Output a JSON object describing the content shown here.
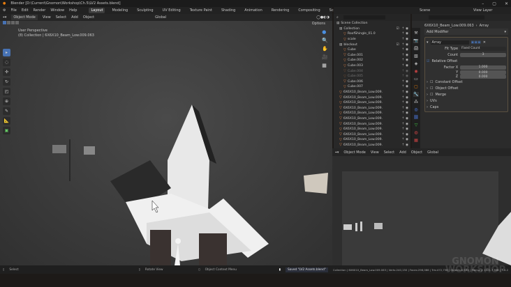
{
  "window": {
    "title": "Blender [D:\\Current\\Gnomon\\Workshop\\Ch.5\\LV2 Assets.blend]"
  },
  "menu": [
    "File",
    "Edit",
    "Render",
    "Window",
    "Help"
  ],
  "workspaces": [
    "Layout",
    "Modeling",
    "Sculpting",
    "UV Editing",
    "Texture Paint",
    "Shading",
    "Animation",
    "Rendering",
    "Compositing",
    "Scripting"
  ],
  "viewport": {
    "mode": "Object Mode",
    "menus": [
      "View",
      "Select",
      "Add",
      "Object"
    ],
    "transform": "Global",
    "options": "Options",
    "perspective": "User Perspective",
    "info": "(8) Collection | 6X6X10_Beam_Low.009.063"
  },
  "topright": {
    "scene": "Scene",
    "view_layer": "View Layer"
  },
  "outliner": {
    "root": "Scene Collection",
    "items": [
      {
        "name": "Collection",
        "type": "collection"
      },
      {
        "name": "RoofShingle_01.0",
        "type": "object"
      },
      {
        "name": "scale",
        "type": "object"
      },
      {
        "name": "blockout",
        "type": "collection"
      },
      {
        "name": "Cube",
        "type": "object"
      },
      {
        "name": "Cube.001",
        "type": "object"
      },
      {
        "name": "Cube.002",
        "type": "object"
      },
      {
        "name": "Cube.003",
        "type": "object"
      },
      {
        "name": "Cube.004",
        "type": "object",
        "hidden": true
      },
      {
        "name": "Cube.005",
        "type": "object",
        "hidden": true
      },
      {
        "name": "Cube.006",
        "type": "object"
      },
      {
        "name": "Cube.007",
        "type": "object"
      },
      {
        "name": "6X6X10_Beam_Low.009.",
        "type": "object"
      },
      {
        "name": "6X6X10_Beam_Low.009.",
        "type": "object"
      },
      {
        "name": "6X6X10_Beam_Low.009.",
        "type": "object"
      },
      {
        "name": "6X6X10_Beam_Low.009.",
        "type": "object"
      },
      {
        "name": "6X6X10_Beam_Low.009.",
        "type": "object"
      },
      {
        "name": "6X6X10_Beam_Low.009.",
        "type": "object"
      },
      {
        "name": "6X6X10_Beam_Low.009.",
        "type": "object"
      },
      {
        "name": "6X6X10_Beam_Low.009.",
        "type": "object"
      },
      {
        "name": "6X6X10_Beam_Low.009.",
        "type": "object"
      },
      {
        "name": "6X6X10_Beam_Low.009.",
        "type": "object"
      },
      {
        "name": "6X6X10_Beam_Low.009.",
        "type": "object"
      }
    ]
  },
  "properties": {
    "object": "6X6X10_Beam_Low.009.063",
    "modifier_crumb": "Array",
    "add_modifier": "Add Modifier",
    "modifier_name": "Array",
    "fit_type_label": "Fit Type",
    "fit_type": "Fixed Count",
    "count_label": "Count",
    "count": "3",
    "relative_offset": "Relative Offset",
    "factor_x_label": "Factor X",
    "factor_x": "1.000",
    "y_label": "Y",
    "y": "0.000",
    "z_label": "Z",
    "z": "0.000",
    "sections": [
      "Constant Offset",
      "Object Offset",
      "Merge",
      "UVs",
      "Caps"
    ]
  },
  "viewport2": {
    "mode": "Object Mode",
    "menus": [
      "View",
      "Select",
      "Add",
      "Object"
    ],
    "transform": "Global"
  },
  "status": {
    "select": "Select",
    "rotate": "Rotate View",
    "context": "Object Context Menu",
    "saved": "Saved \"LV2 Assets.blend\"",
    "stats": "Collection | 6X6X10_Beam_Low.009.063 | Verts:240,150 | Faces:298,086 | Tris:472,736 | Objects:0/165 | Memory: 1021.7 MiB | 3.6.2"
  },
  "watermark": "GNOMON WORKSHOP"
}
